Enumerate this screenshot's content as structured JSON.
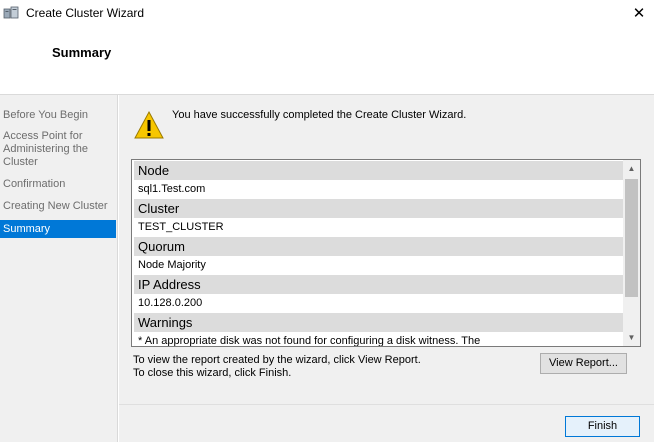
{
  "window": {
    "title": "Create Cluster Wizard",
    "close_glyph": "✕",
    "app_icon": "cluster-wizard-icon"
  },
  "header": {
    "page_title": "Summary"
  },
  "nav": {
    "items": [
      {
        "label": "Before You Begin",
        "active": false
      },
      {
        "label": "Access Point for Administering the Cluster",
        "active": false
      },
      {
        "label": "Confirmation",
        "active": false
      },
      {
        "label": "Creating New Cluster",
        "active": false
      },
      {
        "label": "Summary",
        "active": true
      }
    ]
  },
  "main": {
    "status_icon": "warning-icon",
    "success_message": "You have successfully completed the Create Cluster Wizard.",
    "report": {
      "sections": [
        {
          "heading": "Node",
          "value": "sql1.Test.com"
        },
        {
          "heading": "Cluster",
          "value": "TEST_CLUSTER"
        },
        {
          "heading": "Quorum",
          "value": "Node Majority"
        },
        {
          "heading": "IP Address",
          "value": "10.128.0.200"
        },
        {
          "heading": "Warnings",
          "value": "* An appropriate disk was not found for configuring a disk witness. The"
        }
      ]
    },
    "info_line1": "To view the report created by the wizard, click View Report.",
    "info_line2": "To close this wizard, click Finish.",
    "view_report_label": "View Report..."
  },
  "footer": {
    "finish_label": "Finish"
  },
  "colors": {
    "selection": "#0078d7",
    "section_header_bg": "#dcdcdc",
    "panel_bg": "#f0f0f0"
  }
}
